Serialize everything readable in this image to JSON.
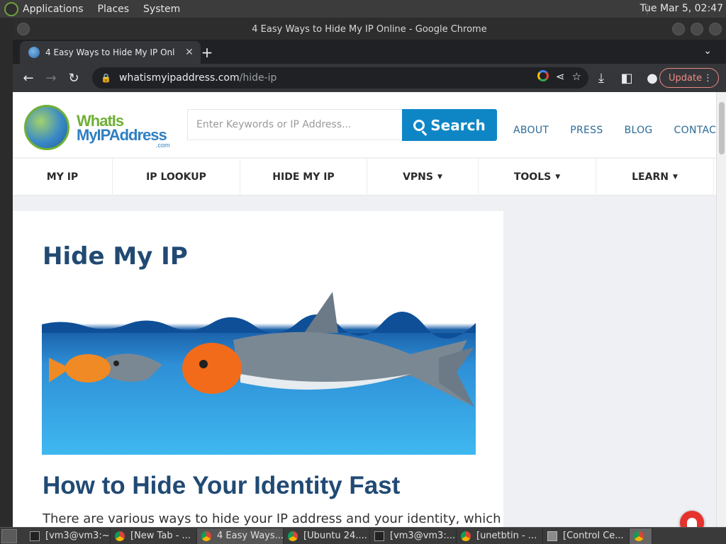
{
  "system_panel": {
    "menus": [
      "Applications",
      "Places",
      "System"
    ],
    "clock": "Tue Mar  5, 02:47"
  },
  "window": {
    "title": "4 Easy Ways to Hide My IP Online - Google Chrome"
  },
  "tabs": {
    "active_title": "4 Easy Ways to Hide My IP Onl",
    "close": "✕",
    "new_tab": "+",
    "tab_search": "⌄"
  },
  "toolbar": {
    "back": "←",
    "forward": "→",
    "reload": "↻",
    "url_domain": "whatismyipaddress.com",
    "url_path": "/hide-ip",
    "update_label": "Update",
    "menu": "⋮"
  },
  "site": {
    "logo": {
      "line1": "WhatIs",
      "line2": "MyIPAddress",
      "line3": ".com"
    },
    "search": {
      "placeholder": "Enter Keywords or IP Address...",
      "button_label": "Search"
    },
    "top_links": [
      "ABOUT",
      "PRESS",
      "BLOG",
      "CONTACT"
    ],
    "nav": [
      {
        "label": "MY IP",
        "dropdown": false
      },
      {
        "label": "IP LOOKUP",
        "dropdown": false
      },
      {
        "label": "HIDE MY IP",
        "dropdown": false
      },
      {
        "label": "VPNS",
        "dropdown": true
      },
      {
        "label": "TOOLS",
        "dropdown": true
      },
      {
        "label": "LEARN",
        "dropdown": true
      }
    ],
    "page_title": "Hide My IP",
    "section_title": "How to Hide Your Identity Fast",
    "intro_text": "There are various ways to hide your IP address and your identity, which"
  },
  "taskbar": {
    "items": [
      {
        "label": "[vm3@vm3:~]",
        "icon": "terminal-icon"
      },
      {
        "label": "[New Tab - ...",
        "icon": "chrome-icon"
      },
      {
        "label": "4 Easy Ways...",
        "icon": "chrome-icon",
        "active": true
      },
      {
        "label": "[Ubuntu 24....",
        "icon": "chrome-icon"
      },
      {
        "label": "[vm3@vm3:...",
        "icon": "terminal-icon"
      },
      {
        "label": "[unetbtin - ...",
        "icon": "chrome-icon"
      },
      {
        "label": "[Control Ce...",
        "icon": "control-center-icon"
      }
    ]
  },
  "colors": {
    "brand_blue": "#214a73",
    "search_button": "#0e86c6",
    "link_blue": "#2b6b98",
    "notification_red": "#e5322d",
    "update_accent": "#f28b82"
  }
}
